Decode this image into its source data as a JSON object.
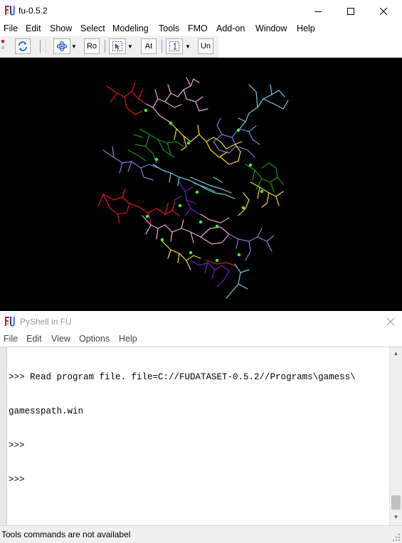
{
  "window": {
    "title": "fu-0.5.2"
  },
  "window_controls": {
    "minimize": "—",
    "maximize": "☐",
    "close": "✕"
  },
  "menu": [
    "File",
    "Edit",
    "Show",
    "Select",
    "Modeling",
    "Tools",
    "FMO",
    "Add-on",
    "Window",
    "Help"
  ],
  "toolbar": {
    "rotate_label": "Ro",
    "atom_label": "At",
    "undo_label": "Un",
    "dropdown_arrow": "▼"
  },
  "viewport": {
    "background": "#000000",
    "colors": {
      "red": "#e01818",
      "pink": "#f0a8e0",
      "yellow": "#f0e030",
      "green": "#1f8f1f",
      "lightblue": "#70d0e0",
      "violet": "#8080e0",
      "purple": "#7020c0",
      "atom": "#40ff40"
    }
  },
  "pyshell": {
    "title": "PyShell in FU",
    "close": "✕",
    "menu": [
      "File",
      "Edit",
      "View",
      "Options",
      "Help"
    ],
    "lines": [
      ">>> Read program file. file=C://FUDATASET-0.5.2//Programs\\gamess\\",
      "gamesspath.win",
      ">>>",
      ">>>"
    ]
  },
  "status": {
    "text": "Tools commands are not availabel"
  }
}
